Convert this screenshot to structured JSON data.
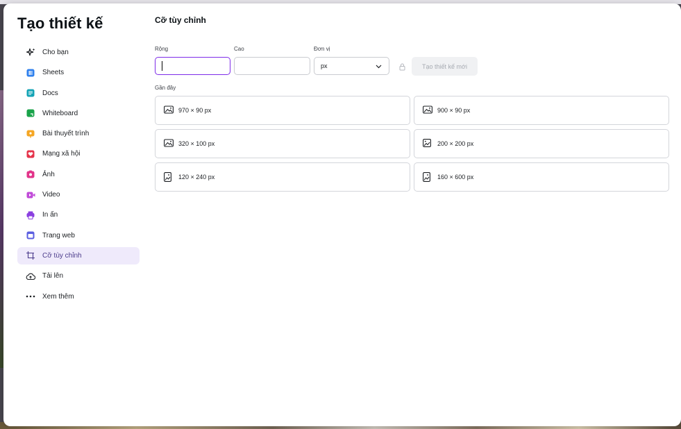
{
  "modal": {
    "title": "Tạo thiết kế"
  },
  "sidebar": {
    "items": [
      {
        "label": "Cho bạn",
        "icon": "sparkle-icon"
      },
      {
        "label": "Sheets",
        "icon": "sheets-icon",
        "color": "#2f80ed"
      },
      {
        "label": "Docs",
        "icon": "docs-icon",
        "color": "#13a3b5"
      },
      {
        "label": "Whiteboard",
        "icon": "whiteboard-icon",
        "color": "#1aa34a"
      },
      {
        "label": "Bài thuyết trình",
        "icon": "presentation-icon",
        "color": "#f5a623"
      },
      {
        "label": "Mạng xã hội",
        "icon": "heart-icon",
        "color": "#e5344b"
      },
      {
        "label": "Ảnh",
        "icon": "camera-icon",
        "color": "#e2348a"
      },
      {
        "label": "Video",
        "icon": "video-icon",
        "color": "#c04ad8"
      },
      {
        "label": "In ấn",
        "icon": "printer-icon",
        "color": "#8a3fe0"
      },
      {
        "label": "Trang web",
        "icon": "webpage-icon",
        "color": "#5b5fe0"
      },
      {
        "label": "Cỡ tùy chỉnh",
        "icon": "custom-size-icon",
        "active": true
      },
      {
        "label": "Tải lên",
        "icon": "cloud-upload-icon"
      },
      {
        "label": "Xem thêm",
        "icon": "more-dots-icon"
      }
    ]
  },
  "custom_size": {
    "title": "Cỡ tùy chỉnh",
    "width_label": "Rộng",
    "width_value": "",
    "height_label": "Cao",
    "height_value": "",
    "unit_label": "Đơn vị",
    "unit_value": "px",
    "create_button": "Tạo thiết kế mới"
  },
  "recent": {
    "label": "Gần đây",
    "items": [
      {
        "label": "970 × 90 px",
        "icon": "landscape-image-icon"
      },
      {
        "label": "900 × 90 px",
        "icon": "landscape-image-icon"
      },
      {
        "label": "320 × 100 px",
        "icon": "landscape-image-icon"
      },
      {
        "label": "200 × 200 px",
        "icon": "square-image-icon"
      },
      {
        "label": "120 × 240 px",
        "icon": "portrait-image-icon"
      },
      {
        "label": "160 × 600 px",
        "icon": "portrait-image-icon"
      }
    ]
  },
  "colors": {
    "accent": "#7d2ae8",
    "active_bg": "#efeafb"
  }
}
